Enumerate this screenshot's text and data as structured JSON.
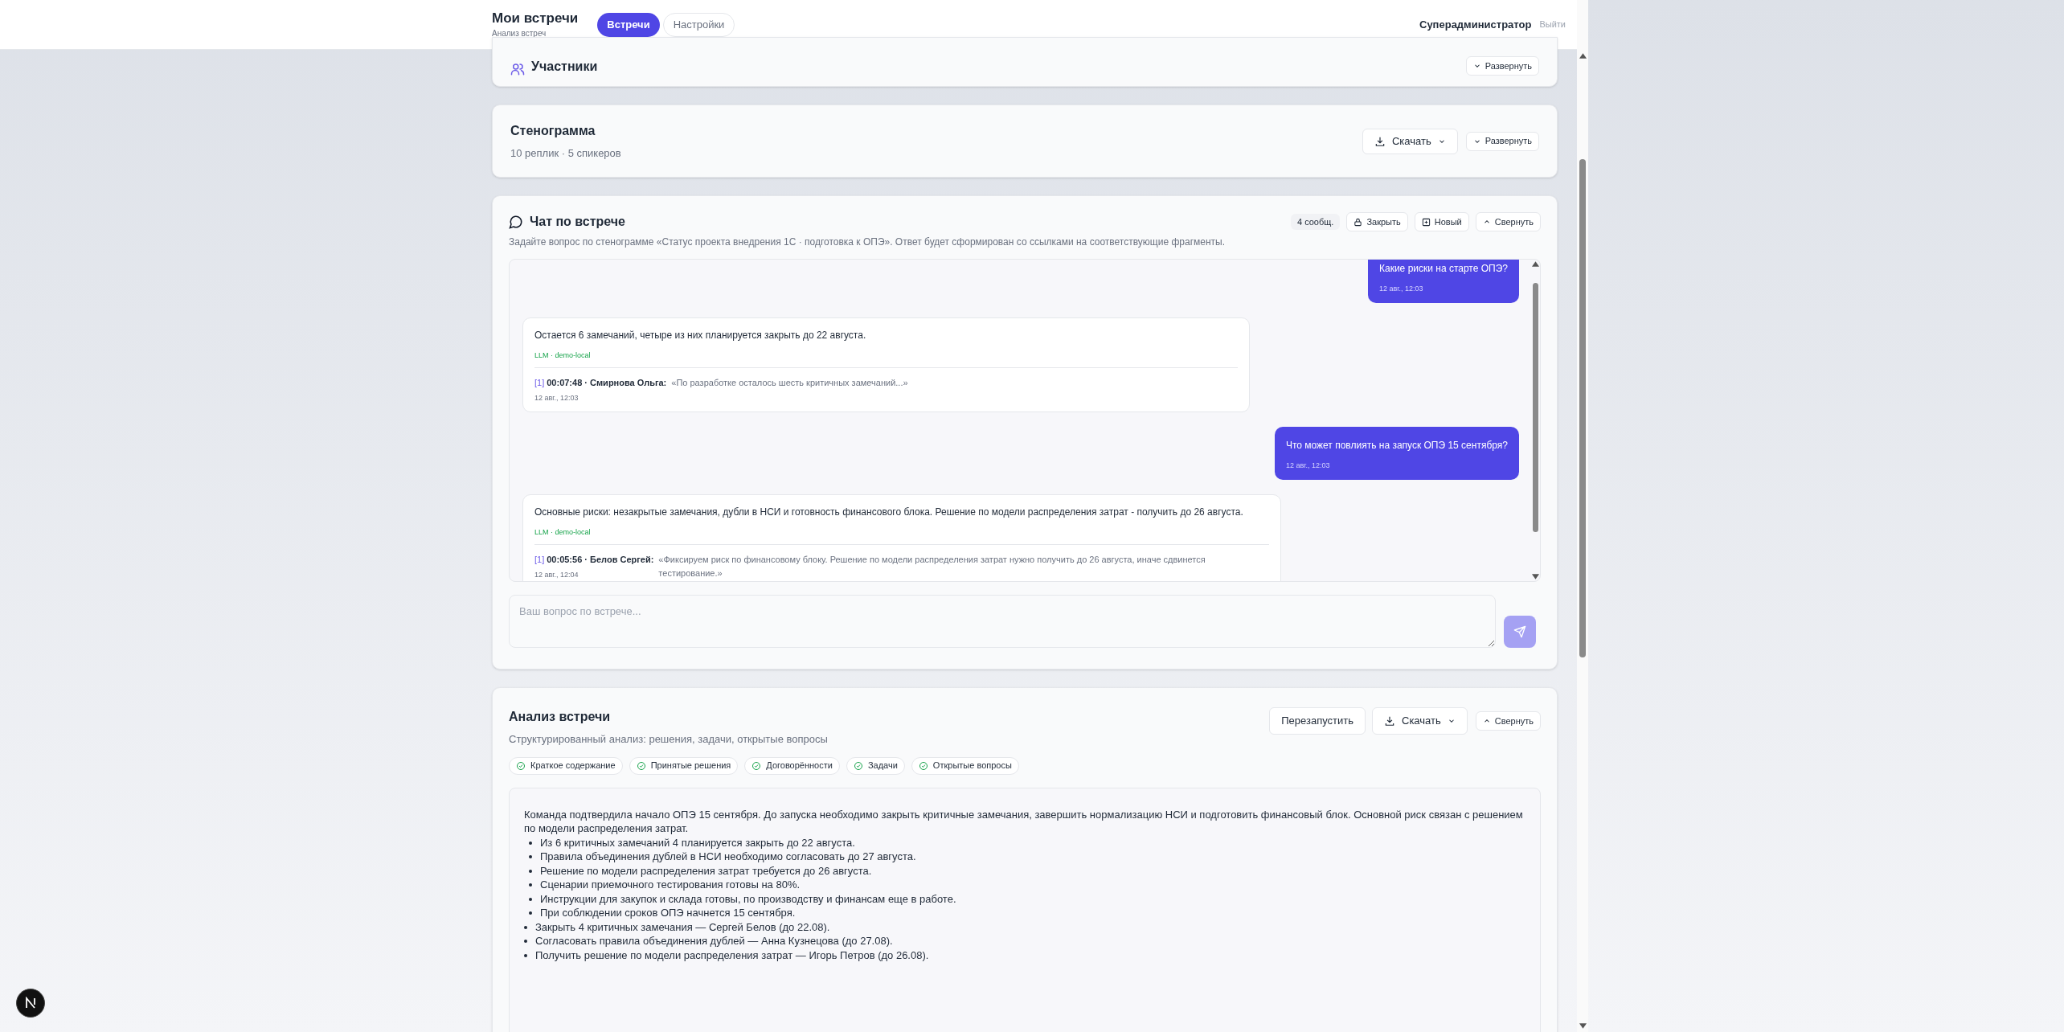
{
  "header": {
    "title": "Мои встречи",
    "subtitle": "Анализ встреч",
    "tabs": [
      {
        "label": "Встречи",
        "selected": true
      },
      {
        "label": "Настройки",
        "selected": false
      }
    ],
    "user": "Суперадминистратор",
    "logout": "Выйти"
  },
  "participants": {
    "title": "Участники",
    "toggle": "Развернуть"
  },
  "transcript": {
    "title": "Стенограмма",
    "meta": "10 реплик · 5 спикеров",
    "download": "Скачать",
    "toggle": "Развернуть"
  },
  "chat": {
    "title": "Чат по встрече",
    "description": "Задайте вопрос по стенограмме «Статус проекта внедрения 1С · подготовка к ОПЭ». Ответ будет сформирован со ссылками на соответствующие фрагменты.",
    "count": "4 сообщ.",
    "close": "Закрыть",
    "new": "Новый",
    "toggle": "Свернуть",
    "messages": [
      {
        "kind": "user",
        "text": "Какие риски на старте ОПЭ?",
        "time": "12 авг., 12:03"
      },
      {
        "kind": "assistant",
        "text": "Остается 6 замечаний, четыре из них планируется закрыть до 22 августа.",
        "model": "LLM · demo-local",
        "citations": [
          {
            "index": "[1]",
            "speaker": "00:07:48 · Смирнова Ольга:",
            "quote": "«По разработке осталось шесть критичных замечаний...»"
          }
        ],
        "time": "12 авг., 12:03"
      },
      {
        "kind": "user",
        "text": "Что может повлиять на запуск ОПЭ 15 сентября?",
        "time": "12 авг., 12:03"
      },
      {
        "kind": "assistant",
        "text": "Основные риски: незакрытые замечания, дубли в НСИ и готовность финансового блока. Решение по модели распределения затрат - получить до 26 августа.",
        "model": "LLM · demo-local",
        "citations": [
          {
            "index": "[1]",
            "speaker": "00:05:56 · Белов Сергей:",
            "quote": "«Фиксируем риск по финансовому блоку. Решение по модели распределения затрат нужно получить до 26 августа, иначе сдвинется тестирование.»"
          }
        ],
        "time": "12 авг., 12:04"
      }
    ],
    "input": {
      "placeholder": "Ваш вопрос по встрече..."
    }
  },
  "analysis": {
    "title": "Анализ встречи",
    "subtitle": "Структурированный анализ: решения, задачи, открытые вопросы",
    "restart": "Перезапустить",
    "download": "Скачать",
    "toggle": "Свернуть",
    "sections": [
      "Краткое содержание",
      "Принятые решения",
      "Договорённости",
      "Задачи",
      "Открытые вопросы"
    ],
    "summary": "Команда подтвердила начало ОПЭ 15 сентября. До запуска необходимо закрыть критичные замечания, завершить нормализацию НСИ и подготовить финансовый блок. Основной риск связан с решением по модели распределения затрат.",
    "items": [
      "Из 6 критичных замечаний 4 планируется закрыть до 22 августа.",
      "Правила объединения дублей в НСИ необходимо согласовать до 27 августа.",
      "Решение по модели распределения затрат требуется до 26 августа.",
      "Сценарии приемочного тестирования готовы на 80%.",
      "Инструкции для закупок и склада готовы, по производству и финансам еще в работе.",
      "При соблюдении сроков ОПЭ начнется 15 сентября.",
      "Закрыть 4 критичных замечания — Сергей Белов (до 22.08).",
      "Согласовать правила объединения дублей — Анна Кузнецова (до 27.08).",
      "Получить решение по модели распределения затрат — Игорь Петров (до 26.08)."
    ]
  }
}
